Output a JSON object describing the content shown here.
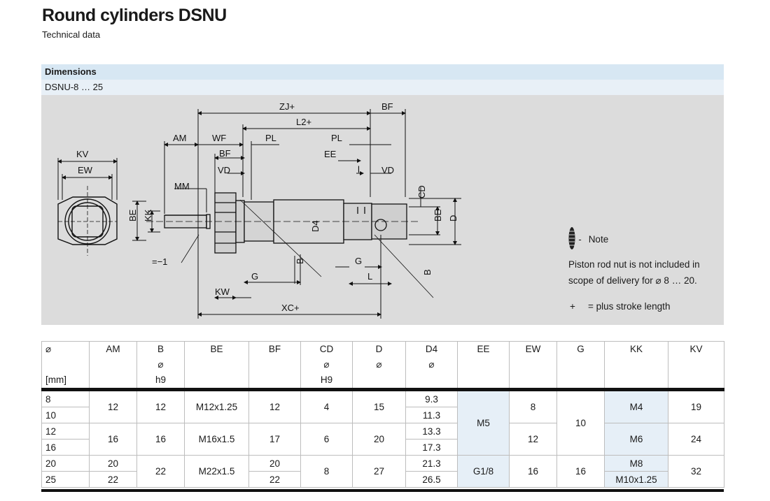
{
  "header": {
    "title": "Round cylinders DSNU",
    "subtitle": "Technical data"
  },
  "section": {
    "title": "Dimensions",
    "variant": "DSNU-8 … 25"
  },
  "drawing": {
    "labels": {
      "zj": "ZJ+",
      "bf_top": "BF",
      "l2": "L2+",
      "am": "AM",
      "wf": "WF",
      "pl1": "PL",
      "pl2": "PL",
      "bf_mid": "BF",
      "ee": "EE",
      "vd1": "VD",
      "vd2": "VD",
      "l_small": "l",
      "mm": "MM",
      "kv": "KV",
      "ew": "EW",
      "be1": "BE",
      "kk": "KK",
      "d4": "D4",
      "cd": "CD",
      "be2": "BE",
      "d": "D",
      "b1": "B",
      "b2": "B",
      "g1": "G",
      "g2": "G",
      "l_cap": "L",
      "kw": "KW",
      "xc": "XC+",
      "wrench": "=−1"
    }
  },
  "note": {
    "title": "Note",
    "text": "Piston rod nut is not included in scope of delivery for ⌀ 8 … 20.",
    "plus_symbol": "+",
    "plus_text": "= plus stroke length"
  },
  "table": {
    "headers": [
      [
        "⌀",
        "",
        "[mm]"
      ],
      [
        "AM",
        "",
        ""
      ],
      [
        "B",
        "⌀",
        "h9"
      ],
      [
        "BE",
        "",
        ""
      ],
      [
        "BF",
        "",
        ""
      ],
      [
        "CD",
        "⌀",
        "H9"
      ],
      [
        "D",
        "⌀",
        ""
      ],
      [
        "D4",
        "⌀",
        ""
      ],
      [
        "EE",
        "",
        ""
      ],
      [
        "EW",
        "",
        ""
      ],
      [
        "G",
        "",
        ""
      ],
      [
        "KK",
        "",
        ""
      ],
      [
        "KV",
        "",
        ""
      ]
    ],
    "diameters": [
      "8",
      "10",
      "12",
      "16",
      "20",
      "25"
    ],
    "am": [
      "12",
      "16",
      "20",
      "22"
    ],
    "b": [
      "12",
      "16",
      "22"
    ],
    "be": [
      "M12x1.25",
      "M16x1.5",
      "M22x1.5"
    ],
    "bf": [
      "12",
      "17",
      "20",
      "22"
    ],
    "cd": [
      "4",
      "6",
      "8"
    ],
    "d": [
      "15",
      "20",
      "27"
    ],
    "d4": [
      "9.3",
      "11.3",
      "13.3",
      "17.3",
      "21.3",
      "26.5"
    ],
    "ee": [
      "M5",
      "G1/8"
    ],
    "ew": [
      "8",
      "12",
      "16"
    ],
    "g": [
      "10",
      "16"
    ],
    "kk": [
      "M4",
      "M6",
      "M8",
      "M10x1.25"
    ],
    "kv": [
      "19",
      "24",
      "32"
    ]
  }
}
